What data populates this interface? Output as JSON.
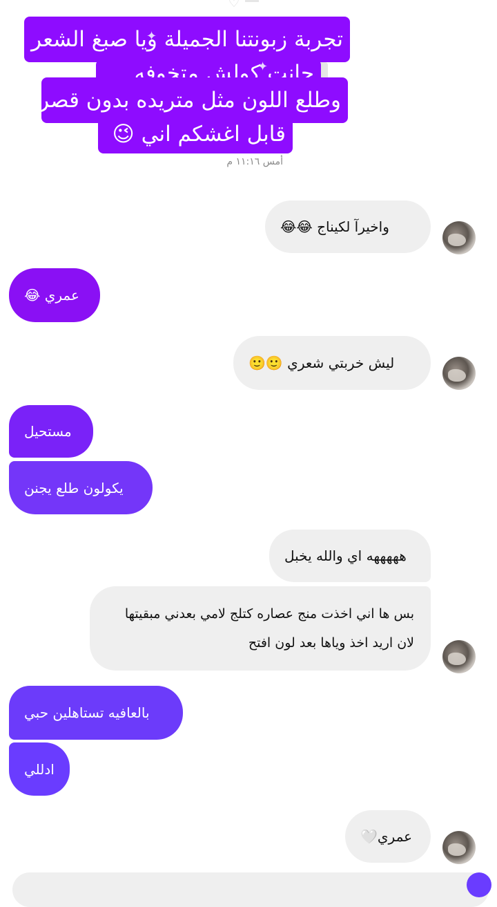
{
  "caption": {
    "lines": [
      "تجربة زبونتنا الجميلة ويا صبغ الشعر",
      "جانت كولش متخوفه",
      "وطلع اللون مثل متريده بدون قصر",
      "قابل اغشكم اني 😉"
    ],
    "timestamp": "أمس ١١:١٦ م",
    "accent": "#8e0cff",
    "top_icon": "white-heart-icon"
  },
  "messages": [
    {
      "side": "incoming",
      "text": "واخيرآ لكيناج 😂😂"
    },
    {
      "side": "outgoing",
      "text": "عمري 😂"
    },
    {
      "side": "incoming",
      "text": "ليش خربتي شعري 🙂🙂"
    },
    {
      "side": "outgoing",
      "text": "مستحيل"
    },
    {
      "side": "outgoing",
      "text": "يكولون طلع يجنن"
    },
    {
      "side": "incoming",
      "text": "هههههه اي والله يخبل"
    },
    {
      "side": "incoming",
      "text": "بس ها اني اخذت منج عصاره كتلج لامي بعدني مبقيتها لان اريد اخذ وياها بعد لون افتح"
    },
    {
      "side": "outgoing",
      "text": "بالعافيه تستاهلين حبي"
    },
    {
      "side": "outgoing",
      "text": "ادللي"
    },
    {
      "side": "incoming",
      "text": "عمري🤍"
    }
  ],
  "colors": {
    "incoming_bg": "#efefef",
    "outgoing_top": "#8a10f4",
    "outgoing_bottom": "#6a3cff"
  },
  "avatar_icon": "user-avatar"
}
